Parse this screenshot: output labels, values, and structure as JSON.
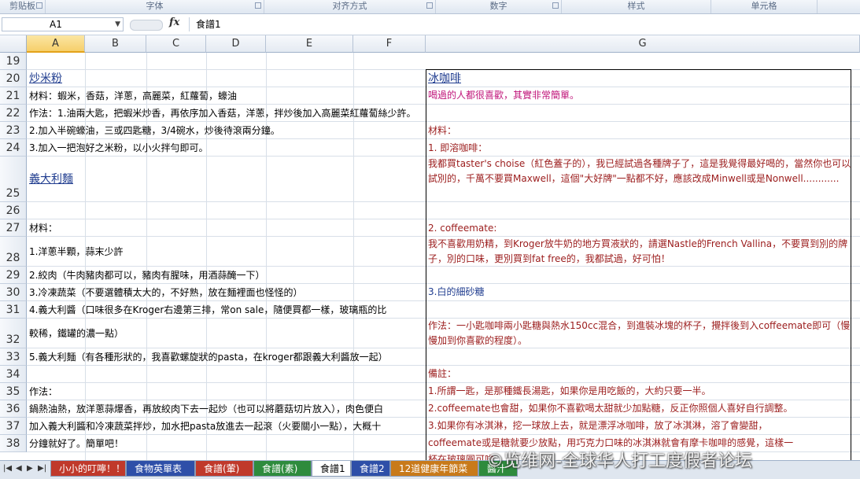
{
  "ribbon": {
    "groups": [
      "剪贴板",
      "字体",
      "对齐方式",
      "数字",
      "样式",
      "单元格"
    ]
  },
  "formula_bar": {
    "name_box": "A1",
    "fx_label": "fx",
    "content": "食譜1"
  },
  "columns": [
    "A",
    "B",
    "C",
    "D",
    "E",
    "F",
    "G"
  ],
  "rows": [
    "19",
    "20",
    "21",
    "22",
    "23",
    "24",
    "25",
    "26",
    "27",
    "28",
    "29",
    "30",
    "31",
    "32",
    "33",
    "34",
    "35",
    "36",
    "37",
    "38"
  ],
  "left": {
    "r20": "炒米粉",
    "r21": "材料：蝦米，香菇，洋蔥，高麗菜，紅蘿蔔，蠔油",
    "r22": "作法：1.油兩大匙，把蝦米炒香，再依序加入香菇，洋蔥，拌炒後加入高麗菜紅蘿蔔絲少許。",
    "r23": " 2.加入半碗蠔油，三或四匙糖，3/4碗水，炒後待滾兩分鐘。",
    "r24": " 3.加入一把泡好之米粉，以小火拌勻即可。",
    "r25": "義大利麵",
    "r27": "材料：",
    "r28": "1.洋蔥半顆，蒜末少許",
    "r29": "2.絞肉（牛肉豬肉都可以，豬肉有腥味，用酒蒜醃一下）",
    "r30": "3.冷凍蔬菜（不要選體積太大的，不好熟，放在麵裡面也怪怪的）",
    "r31": "4.義大利醬（口味很多在Kroger右邊第三排，常on sale，隨便買都一樣，玻璃瓶的比",
    "r32": "較稀，鐵罐的濃一點）",
    "r33": "5.義大利麵（有各種形狀的，我喜歡螺旋狀的pasta，在kroger都跟義大利醬放一起）",
    "r35": "作法：",
    "r36": "鍋熱油熱，放洋蔥蒜爆香，再放絞肉下去一起炒（也可以將蘑菇切片放入），肉色便白",
    "r37": "加入義大利醬和冷凍蔬菜拌炒，加水把pasta放進去一起滾（火要關小一點），大概十",
    "r38": "分鐘就好了。簡單吧！"
  },
  "right": {
    "r20": "冰咖啡",
    "r21": "喝過的人都很喜歡，其實非常簡單。",
    "r23": "材料：",
    "r24": "1. 即溶咖啡：",
    "r25": "我都買taster's choise（紅色蓋子的），我已經試過各種牌子了，這是我覺得最好喝的，當然你也可以試別的，千萬不要買Maxwell，這個\"大好牌\"一點都不好，應該改成Minwell或是Nonwell............",
    "r27": "2. coffeemate:",
    "r28": "我不喜歡用奶精，到Kroger放牛奶的地方買液狀的，請選Nastle的French Vallina，不要買到別的牌子，別的口味，更別買到fat free的，我都試過，好可怕！",
    "r30": "3.白的細砂糖",
    "r32": "作法：一小匙咖啡兩小匙糖與熱水150cc混合，到進裝冰塊的杯子，攪拌後到入coffeemate即可（慢慢加到你喜歡的程度）。",
    "r34": "備註：",
    "r35": "1.所謂一匙，是那種鐵長湯匙，如果你是用吃飯的，大約只要一半。",
    "r36": "2.coffeemate也會甜，如果你不喜歡喝太甜就少加點糖，反正你照個人喜好自行調整。",
    "r37": "3.如果你有冰淇淋，挖一球放上去，就是漂浮冰咖啡，放了冰淇淋，溶了會變甜，",
    "r38": "coffeemate或是糖就要少放點，用巧克力口味的冰淇淋就會有摩卡咖啡的感覺，這樣一",
    "r39": "杯在玻璃圓可啡"
  },
  "sheet_tabs": [
    "小小的叮嚀！！",
    "食物英單表",
    "食譜(葷)",
    "食譜(素)",
    "食譜1",
    "食譜2",
    "12道健康年節菜",
    "醬汁"
  ],
  "sheet_tab_colors": [
    "#c0392b",
    "#2e4fa8",
    "#c0392b",
    "#2e8b3d",
    "#ffffff",
    "#2e4fa8",
    "#c87a1a",
    "#2e8b3d"
  ],
  "active_tab": "食譜1",
  "watermark": "©览维网-全球华人打工度假者论坛",
  "colors": {
    "heading_blue": "#1f3c8f",
    "pink_text": "#c0157a",
    "red_text": "#9b1c1c",
    "blue_text": "#1f3c8f"
  }
}
